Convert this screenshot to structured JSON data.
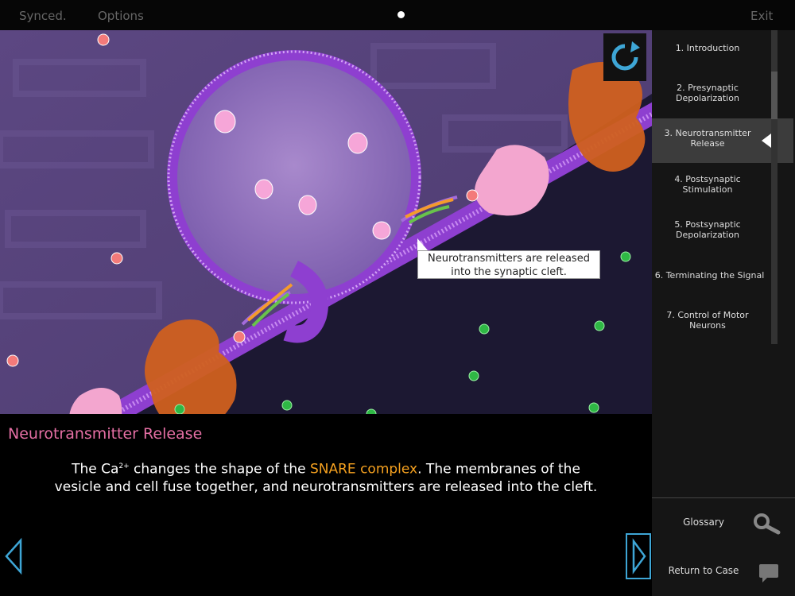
{
  "topbar": {
    "synced": "Synced.",
    "options": "Options",
    "exit": "Exit"
  },
  "scene": {
    "callout": "Neurotransmitters are released into the synaptic cleft."
  },
  "sidebar": {
    "items": [
      {
        "label": "1. Introduction"
      },
      {
        "label": "2. Presynaptic Depolarization"
      },
      {
        "label": "3. Neurotransmitter Release"
      },
      {
        "label": "4. Postsynaptic Stimulation"
      },
      {
        "label": "5. Postsynaptic Depolarization"
      },
      {
        "label": "6. Terminating the Signal"
      },
      {
        "label": "7. Control of Motor Neurons"
      }
    ],
    "active_index": 2,
    "glossary": "Glossary",
    "return": "Return to Case"
  },
  "caption": {
    "title": "Neurotransmitter Release",
    "text_pre": "The Ca",
    "superscript": "2+",
    "text_mid": " changes the shape of the ",
    "highlight": "SNARE complex",
    "text_post": ".  The membranes of the vesicle and cell fuse together, and neurotransmitters are released into the cleft."
  },
  "colors": {
    "accent_pink": "#e56fa4",
    "highlight_orange": "#f4a01f",
    "nav_blue": "#3ea6d6",
    "membrane_purple": "#9b45d4"
  }
}
